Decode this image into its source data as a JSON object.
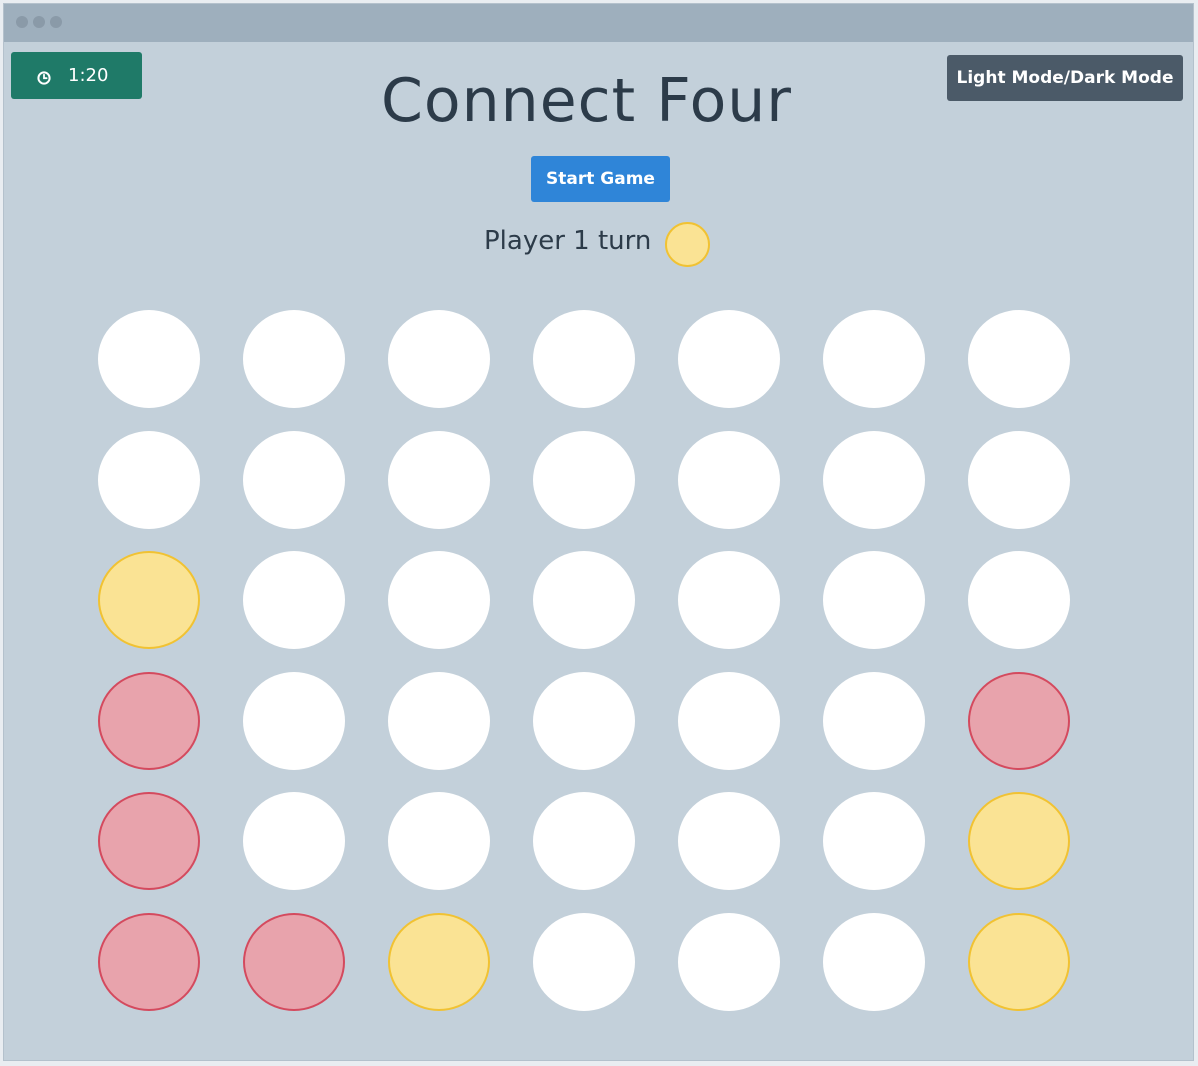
{
  "app": {
    "title": "Connect Four"
  },
  "timer": {
    "icon": "clock-icon",
    "value": "1:20"
  },
  "toolbar": {
    "mode_label": "Light Mode/Dark Mode",
    "start_label": "Start Game"
  },
  "status": {
    "turn_text": "Player 1 turn",
    "current_player": "p1"
  },
  "colors": {
    "background": "#c3d0da",
    "empty_slot": "#ffffff",
    "player1_fill": "#fae394",
    "player1_border": "#f1c232",
    "player2_fill": "#e8a3ac",
    "player2_border": "#d44a5e",
    "timer_bg": "#1f7a68",
    "start_button_bg": "#2f85d8",
    "mode_button_bg": "#4b5a68"
  },
  "board": {
    "rows": 6,
    "cols": 7,
    "cells": [
      [
        "empty",
        "empty",
        "empty",
        "empty",
        "empty",
        "empty",
        "empty"
      ],
      [
        "empty",
        "empty",
        "empty",
        "empty",
        "empty",
        "empty",
        "empty"
      ],
      [
        "p1",
        "empty",
        "empty",
        "empty",
        "empty",
        "empty",
        "empty"
      ],
      [
        "p2",
        "empty",
        "empty",
        "empty",
        "empty",
        "empty",
        "p2"
      ],
      [
        "p2",
        "empty",
        "empty",
        "empty",
        "empty",
        "empty",
        "p1"
      ],
      [
        "p2",
        "p2",
        "p1",
        "empty",
        "empty",
        "empty",
        "p1"
      ]
    ]
  }
}
